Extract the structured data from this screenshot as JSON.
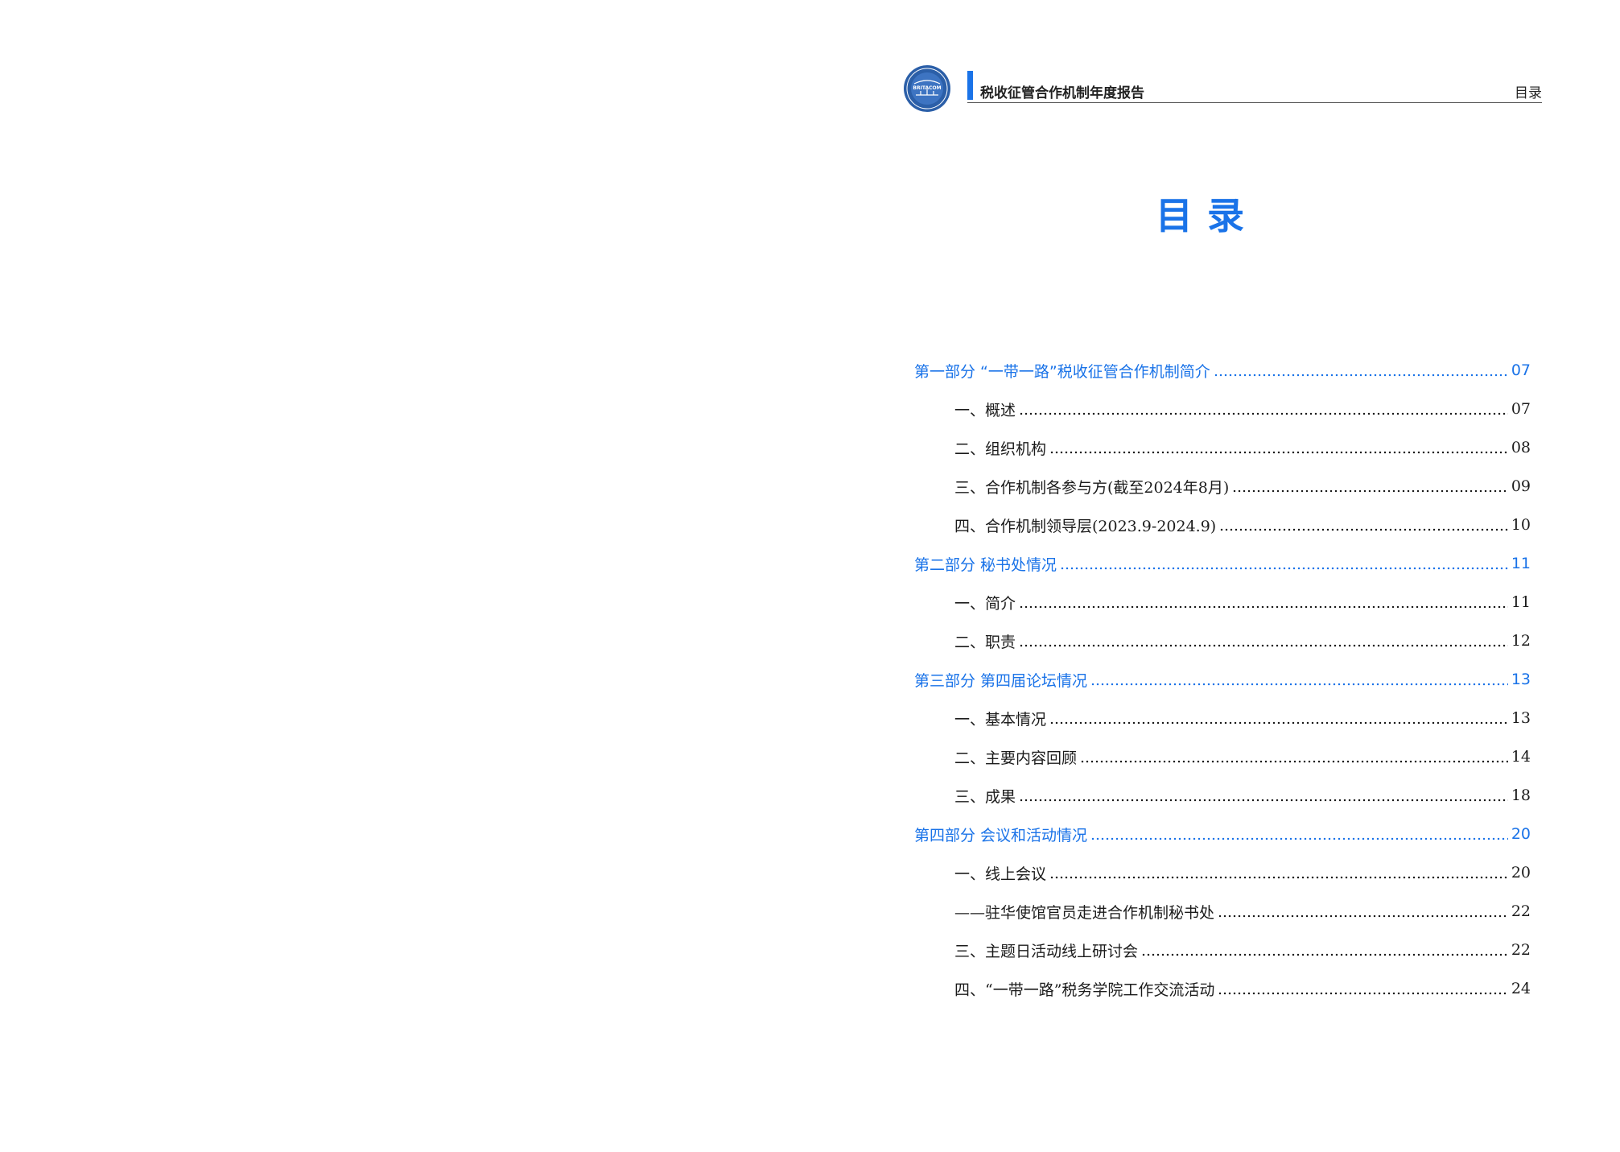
{
  "header": {
    "logo_text": "BRITACOM",
    "report_title": "税收征管合作机制年度报告",
    "section_label": "目录"
  },
  "toc": {
    "title": "目录",
    "entries": [
      {
        "label": "第一部分 “一带一路”税收征管合作机制简介",
        "page": "07",
        "level": "part"
      },
      {
        "label": "一、概述",
        "page": "07",
        "level": "item"
      },
      {
        "label": "二、组织机构",
        "page": "08",
        "level": "item"
      },
      {
        "label": "三、合作机制各参与方(截至2024年8月)",
        "page": "09",
        "level": "item"
      },
      {
        "label": "四、合作机制领导层(2023.9-2024.9)",
        "page": "10",
        "level": "item"
      },
      {
        "label": "第二部分  秘书处情况",
        "page": "11",
        "level": "part"
      },
      {
        "label": "一、简介",
        "page": "11",
        "level": "item"
      },
      {
        "label": "二、职责",
        "page": "12",
        "level": "item"
      },
      {
        "label": "第三部分  第四届论坛情况",
        "page": "13",
        "level": "part"
      },
      {
        "label": "一、基本情况",
        "page": "13",
        "level": "item"
      },
      {
        "label": "二、主要内容回顾",
        "page": "14",
        "level": "item"
      },
      {
        "label": "三、成果",
        "page": "18",
        "level": "item"
      },
      {
        "label": "第四部分  会议和活动情况",
        "page": "20",
        "level": "part"
      },
      {
        "label": "一、线上会议",
        "page": "20",
        "level": "item"
      },
      {
        "label": "——驻华使馆官员走进合作机制秘书处",
        "page": "22",
        "level": "item"
      },
      {
        "label": "三、主题日活动线上研讨会",
        "page": "22",
        "level": "item"
      },
      {
        "label": "四、“一带一路”税务学院工作交流活动",
        "page": "24",
        "level": "item"
      }
    ]
  },
  "colors": {
    "accent": "#1a73e8",
    "text": "#1b1b1b",
    "logo_blue": "#2b5fa8"
  },
  "icons": {
    "logo": "britacom-seal-icon"
  }
}
